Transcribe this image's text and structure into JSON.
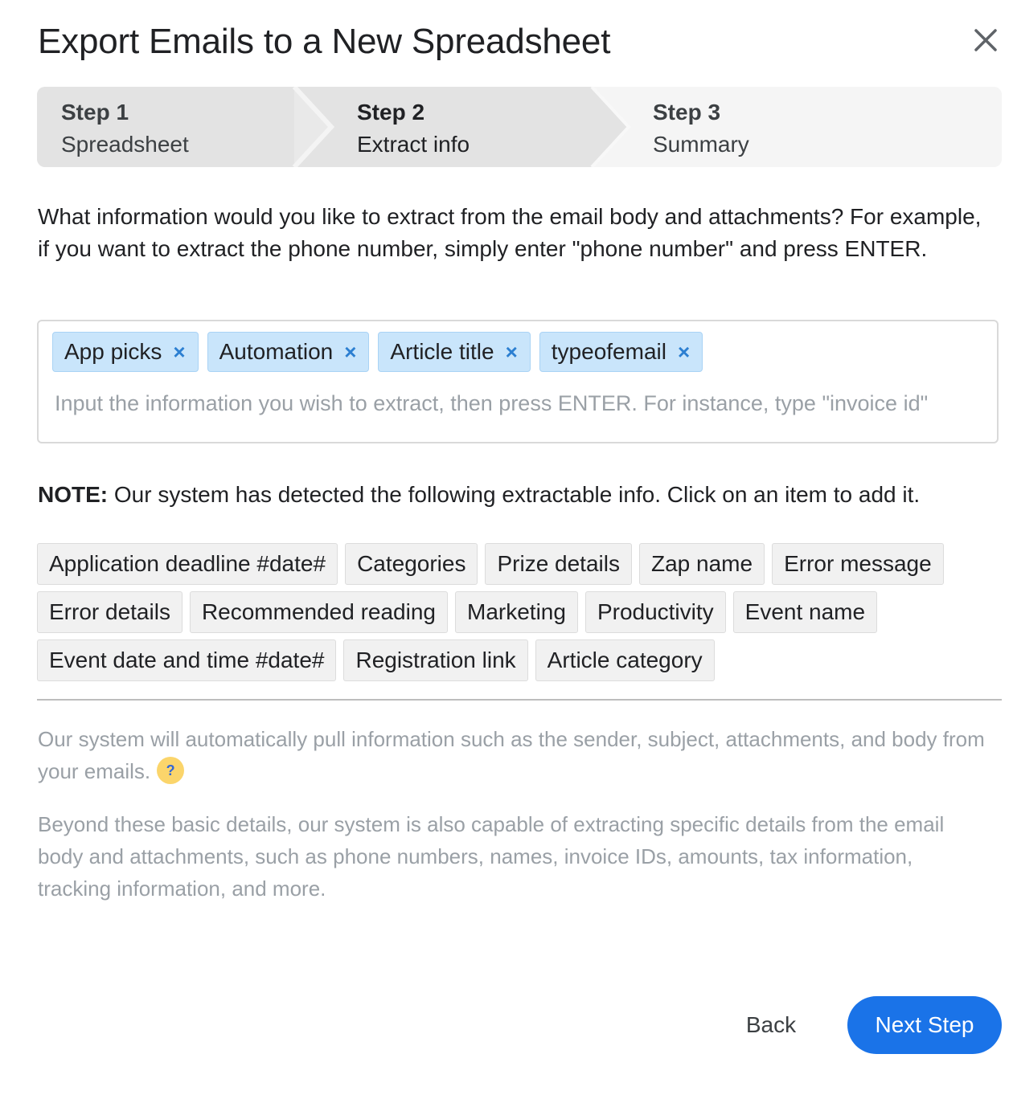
{
  "dialog": {
    "title": "Export Emails to a New Spreadsheet",
    "close_icon": "close-icon"
  },
  "stepper": {
    "steps": [
      {
        "number": "Step 1",
        "name": "Spreadsheet",
        "state": "completed"
      },
      {
        "number": "Step 2",
        "name": "Extract info",
        "state": "active"
      },
      {
        "number": "Step 3",
        "name": "Summary",
        "state": "upcoming"
      }
    ]
  },
  "intro_text": "What information would you like to extract from the email body and attachments? For example, if you want to extract the phone number, simply enter \"phone number\" and press ENTER.",
  "tag_input": {
    "tags": [
      {
        "label": "App picks",
        "remove": "×"
      },
      {
        "label": "Automation",
        "remove": "×"
      },
      {
        "label": "Article title",
        "remove": "×"
      },
      {
        "label": "typeofemail",
        "remove": "×"
      }
    ],
    "value": "",
    "placeholder": "Input the information you wish to extract, then press ENTER. For instance, type \"invoice id\""
  },
  "note": {
    "prefix": "NOTE:",
    "text": " Our system has detected the following extractable info. Click on an item to add it."
  },
  "suggestions": {
    "row1": [
      "Application deadline #date#",
      "Categories",
      "Prize details",
      "Zap name",
      "Error message"
    ],
    "row2": [
      "Error details",
      "Recommended reading",
      "Marketing",
      "Productivity",
      "Event name"
    ],
    "row3": [
      "Event date and time #date#",
      "Registration link",
      "Article category"
    ]
  },
  "info": {
    "auto_text": "Our system will automatically pull information such as the sender, subject, attachments, and body from your emails.",
    "help_glyph": "?",
    "extra_text": "Beyond these basic details, our system is also capable of extracting specific details from the email body and attachments, such as phone numbers, names, invoice IDs, amounts, tax information, tracking information, and more."
  },
  "footer": {
    "back_label": "Back",
    "next_label": "Next Step",
    "accent_color": "#1a73e8"
  }
}
